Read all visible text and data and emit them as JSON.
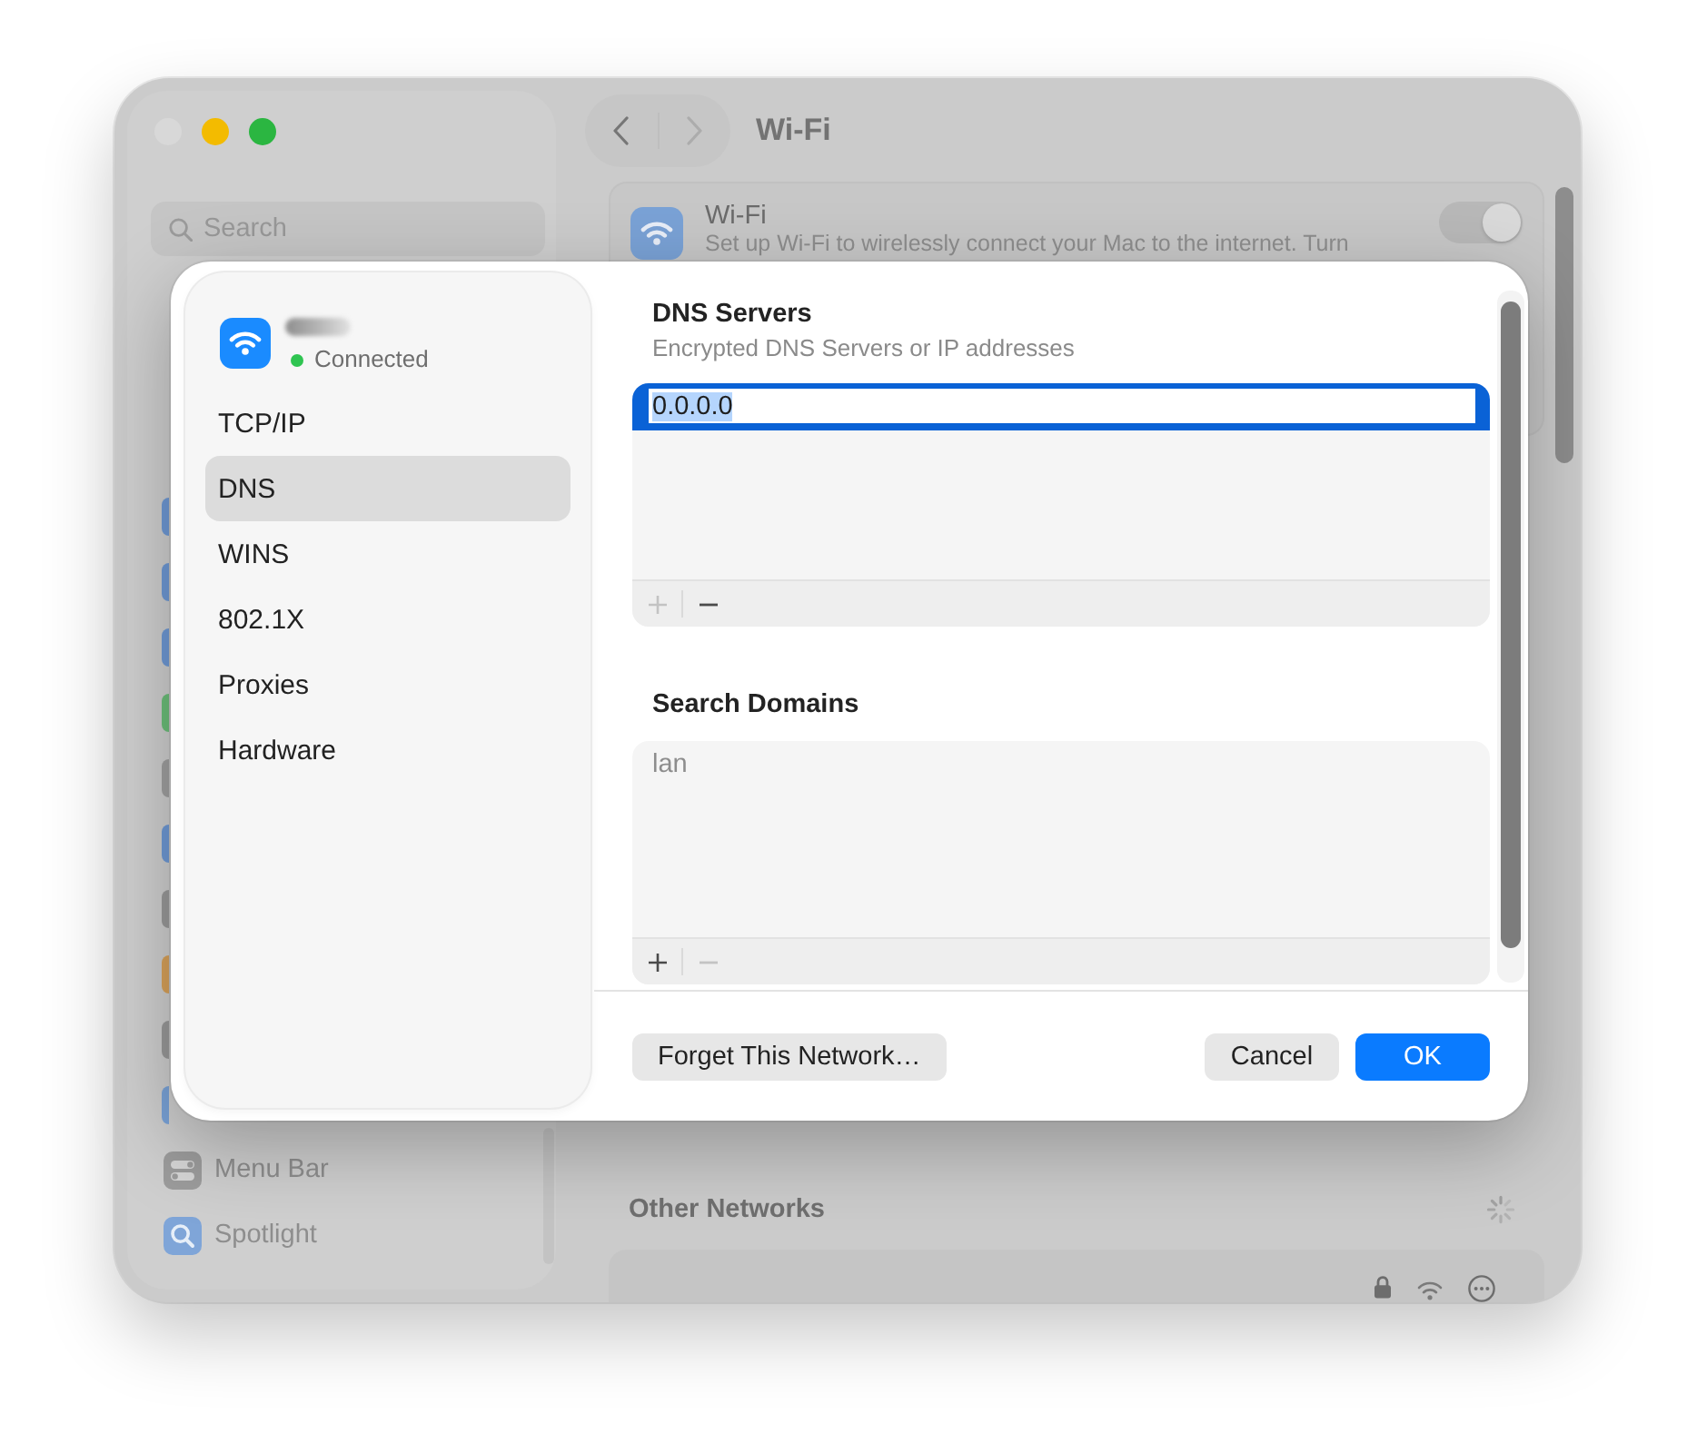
{
  "window_controls": [
    {
      "kind": "close",
      "disabled": true
    },
    {
      "kind": "minimize",
      "disabled": false
    },
    {
      "kind": "zoom",
      "disabled": false
    }
  ],
  "sidebar": {
    "search": {
      "placeholder": "Search"
    },
    "items": [
      {
        "label": "Menu Bar",
        "selected": false
      },
      {
        "label": "Spotlight",
        "selected": false
      }
    ]
  },
  "header": {
    "nav_buttons": [
      {
        "kind": "back",
        "disabled": false
      },
      {
        "kind": "forward",
        "disabled": true
      }
    ],
    "title": "Wi-Fi"
  },
  "wifi_row": {
    "title": "Wi-Fi",
    "description": "Set up Wi-Fi to wirelessly connect your Mac to the internet. Turn",
    "on": true
  },
  "other_networks": {
    "title": "Other Networks"
  },
  "dialog": {
    "network": {
      "status": "Connected"
    },
    "tabs": [
      {
        "label": "TCP/IP",
        "selected": false
      },
      {
        "label": "DNS",
        "selected": true
      },
      {
        "label": "WINS",
        "selected": false
      },
      {
        "label": "802.1X",
        "selected": false
      },
      {
        "label": "Proxies",
        "selected": false
      },
      {
        "label": "Hardware",
        "selected": false
      }
    ],
    "sections": [
      {
        "title": "DNS Servers",
        "subtitle": "Encrypted DNS Servers or IP addresses",
        "entries": [
          {
            "value": "0.0.0.0",
            "selected": true,
            "disabled": false
          }
        ],
        "controls": [
          {
            "kind": "add",
            "disabled": true
          },
          {
            "kind": "remove",
            "disabled": false
          }
        ]
      },
      {
        "title": "Search Domains",
        "entries": [
          {
            "value": "lan",
            "selected": false,
            "disabled": true
          }
        ],
        "controls": [
          {
            "kind": "add",
            "disabled": false
          },
          {
            "kind": "remove",
            "disabled": true
          }
        ]
      }
    ],
    "buttons": [
      {
        "label": "Forget This Network…",
        "kind": "secondary"
      },
      {
        "label": "Cancel",
        "kind": "secondary"
      },
      {
        "label": "OK",
        "kind": "primary"
      }
    ]
  }
}
